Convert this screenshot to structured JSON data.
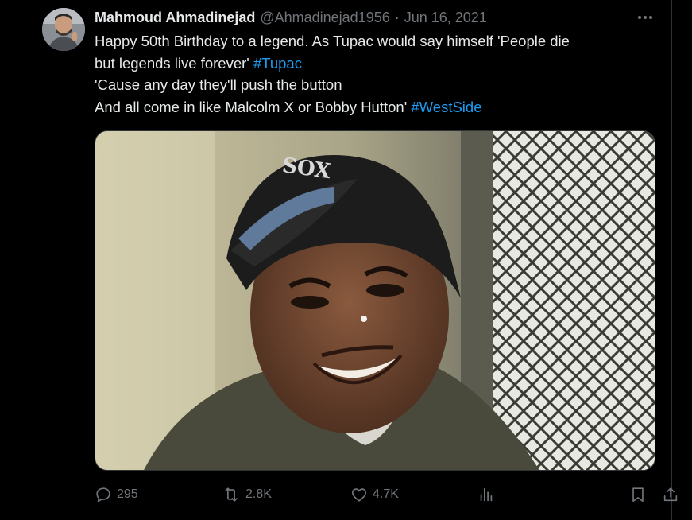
{
  "tweet": {
    "display_name": "Mahmoud Ahmadinejad",
    "handle": "@Ahmadinejad1956",
    "separator": "·",
    "date": "Jun 16, 2021",
    "text_line1": "Happy 50th Birthday to a legend. As Tupac would say himself 'People die",
    "text_line2": "but legends live forever' ",
    "hashtag1": "#Tupac",
    "text_line3": "'Cause any day they'll push the button",
    "text_line4": "And all come in like Malcolm X or Bobby Hutton' ",
    "hashtag2": "#WestSide"
  },
  "actions": {
    "replies": "295",
    "reposts": "2.8K",
    "likes": "4.7K"
  },
  "icons": {
    "more": "more-icon",
    "reply": "reply-icon",
    "repost": "repost-icon",
    "like": "heart-icon",
    "views": "views-icon",
    "bookmark": "bookmark-icon",
    "share": "share-icon"
  },
  "colors": {
    "background": "#000000",
    "text": "#e7e9ea",
    "secondary": "#71767b",
    "link": "#1d9bf0",
    "border": "#2f3336"
  }
}
